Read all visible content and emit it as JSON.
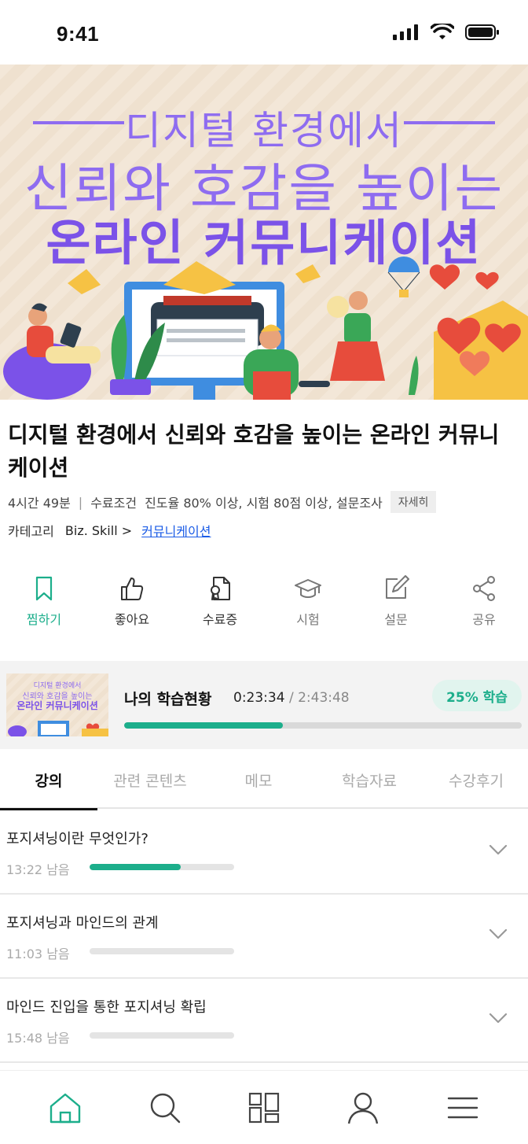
{
  "status_bar": {
    "time": "9:41"
  },
  "banner": {
    "line1": "디지털 환경에서",
    "line2": "신뢰와 호감을 높이는",
    "line3": "온라인 커뮤니케이션"
  },
  "course": {
    "title": "디지털 환경에서 신뢰와 호감을 높이는 온라인 커뮤니케이션",
    "duration": "4시간 49분",
    "completion_label": "수료조건",
    "completion_value": "진도율 80% 이상, 시험 80점 이상, 설문조사",
    "detail_button": "자세히",
    "category_label": "카테고리",
    "category_path": "Biz. Skill >",
    "category_link": "커뮤니케이션"
  },
  "actions": [
    {
      "label": "찜하기",
      "icon": "bookmark-icon"
    },
    {
      "label": "좋아요",
      "icon": "thumbs-up-icon"
    },
    {
      "label": "수료증",
      "icon": "certificate-icon"
    },
    {
      "label": "시험",
      "icon": "graduation-cap-icon"
    },
    {
      "label": "설문",
      "icon": "edit-icon"
    },
    {
      "label": "공유",
      "icon": "share-icon"
    }
  ],
  "progress": {
    "thumb_line1": "디지털 환경에서",
    "thumb_line2": "신뢰와 호감을 높이는",
    "thumb_line3": "온라인 커뮤니케이션",
    "title": "나의 학습현황",
    "current": "0:23:34",
    "total": "/ 2:43:48",
    "badge": "25% 학습",
    "fraction": 0.4
  },
  "tabs": [
    {
      "label": "강의"
    },
    {
      "label": "관련 콘텐츠"
    },
    {
      "label": "메모"
    },
    {
      "label": "학습자료"
    },
    {
      "label": "수강후기"
    }
  ],
  "lectures": [
    {
      "title": "포지셔닝이란 무엇인가?",
      "remaining": "13:22 남음",
      "progress": 0.63
    },
    {
      "title": "포지셔닝과 마인드의 관계",
      "remaining": "11:03 남음",
      "progress": 0
    },
    {
      "title": "마인드 진입을 통한 포지셔닝 확립",
      "remaining": "15:48 남음",
      "progress": 0
    }
  ],
  "bottom_nav": [
    {
      "icon": "home-icon"
    },
    {
      "icon": "search-icon"
    },
    {
      "icon": "grid-icon"
    },
    {
      "icon": "user-icon"
    },
    {
      "icon": "menu-icon"
    }
  ],
  "colors": {
    "accent": "#1cae8b",
    "banner_purple": "#7b52e8",
    "link": "#1b5ce6"
  }
}
